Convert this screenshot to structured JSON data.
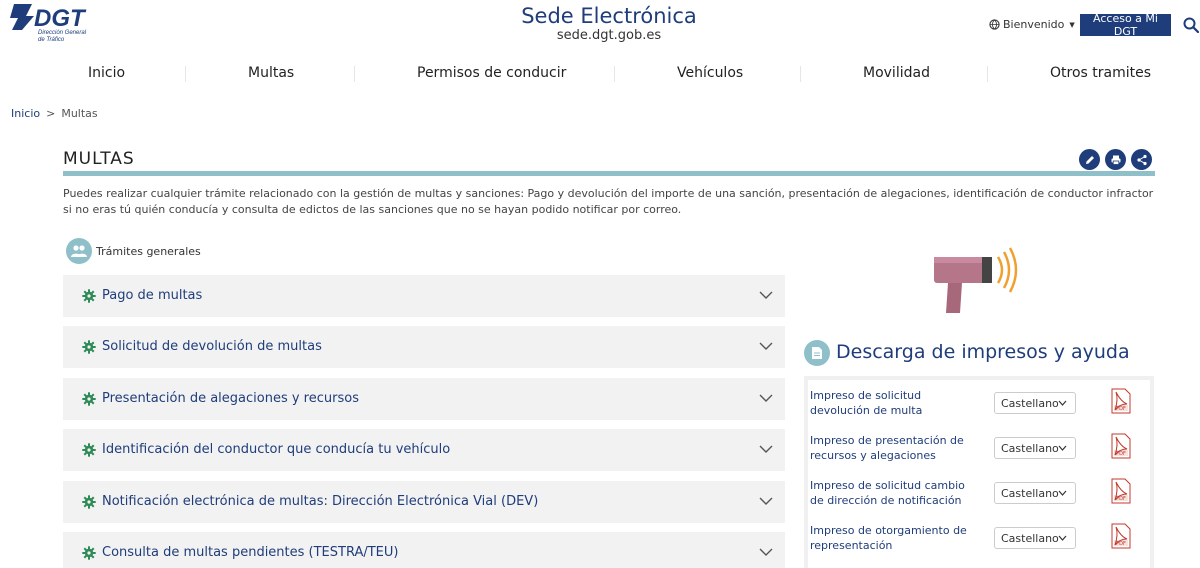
{
  "header": {
    "logo_text": "DGT",
    "logo_sub_1": "Dirección General",
    "logo_sub_2": "de Tráfico",
    "site_title": "Sede Electrónica",
    "site_url": "sede.dgt.gob.es",
    "welcome_label": "Bienvenido",
    "mi_dgt_label": "Acceso a Mi DGT"
  },
  "nav": {
    "items": [
      {
        "label": "Inicio"
      },
      {
        "label": "Multas"
      },
      {
        "label": "Permisos de conducir"
      },
      {
        "label": "Vehículos"
      },
      {
        "label": "Movilidad"
      },
      {
        "label": "Otros tramites"
      }
    ]
  },
  "breadcrumb": {
    "home": "Inicio",
    "separator": ">",
    "current": "Multas"
  },
  "page": {
    "title": "MULTAS",
    "intro": "Puedes realizar cualquier trámite relacionado con la gestión de multas y sanciones: Pago y devolución del importe de una sanción, presentación de alegaciones, identificación de conductor infractor si no eras tú quién conducía y consulta de edictos de las sanciones que no se hayan podido notificar por correo."
  },
  "section": {
    "label": "Trámites generales"
  },
  "accordion": [
    {
      "label": "Pago de multas"
    },
    {
      "label": "Solicitud de devolución de multas"
    },
    {
      "label": "Presentación de alegaciones y recursos"
    },
    {
      "label": "Identificación del conductor que conducía tu vehículo"
    },
    {
      "label": "Notificación electrónica de multas: Dirección Electrónica Vial (DEV)"
    },
    {
      "label": "Consulta de multas pendientes (TESTRA/TEU)"
    }
  ],
  "downloads": {
    "title": "Descarga de impresos y ayuda",
    "rows": [
      {
        "label": "Impreso de solicitud devolución de multa",
        "language": "Castellano"
      },
      {
        "label": "Impreso de presentación de recursos y alegaciones",
        "language": "Castellano"
      },
      {
        "label": "Impreso de solicitud cambio de dirección de notificación",
        "language": "Castellano"
      },
      {
        "label": "Impreso de otorgamiento de representación",
        "language": "Castellano"
      }
    ]
  },
  "colors": {
    "brand_blue": "#1f3d7a",
    "accent_teal": "#8fbfc8",
    "accordion_bg": "#f2f2f2",
    "gear_green": "#2e8b57"
  }
}
